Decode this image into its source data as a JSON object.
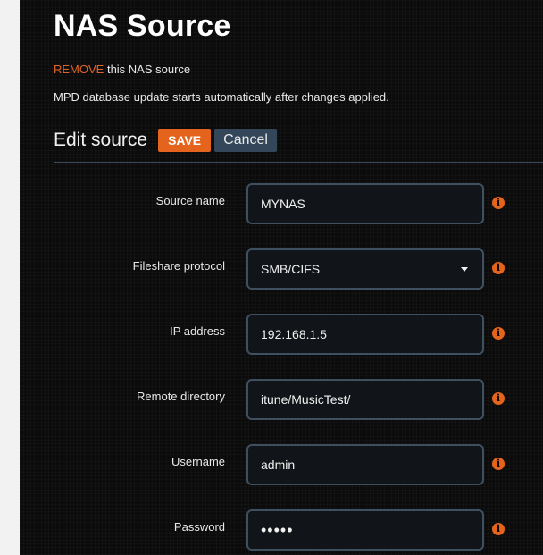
{
  "header": {
    "title": "NAS Source",
    "remove_link": "REMOVE",
    "remove_suffix": " this NAS source",
    "info_text": "MPD database update starts automatically after changes applied."
  },
  "edit": {
    "title": "Edit source",
    "save_label": "SAVE",
    "cancel_label": "Cancel"
  },
  "fields": [
    {
      "label": "Source name",
      "value": "MYNAS"
    },
    {
      "label": "Fileshare protocol",
      "value": "SMB/CIFS"
    },
    {
      "label": "IP address",
      "value": "192.168.1.5"
    },
    {
      "label": "Remote directory",
      "value": "itune/MusicTest/"
    },
    {
      "label": "Username",
      "value": "admin"
    },
    {
      "label": "Password",
      "value": "•••••"
    }
  ],
  "colors": {
    "accent": "#e4641e",
    "cancel_bg": "#34475a",
    "input_border": "#3e4f60"
  },
  "icons": {
    "info": "info-circle-icon"
  }
}
